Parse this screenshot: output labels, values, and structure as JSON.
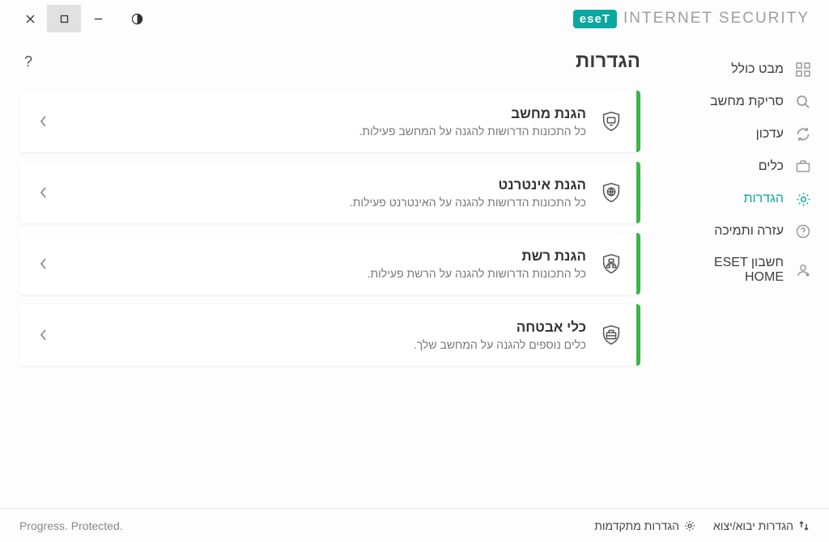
{
  "brand": {
    "logo": "eseT",
    "name": "INTERNET SECURITY"
  },
  "sidebar": {
    "items": [
      {
        "label": "מבט כולל"
      },
      {
        "label": "סריקת מחשב"
      },
      {
        "label": "עדכון"
      },
      {
        "label": "כלים"
      },
      {
        "label": "הגדרות"
      },
      {
        "label": "עזרה ותמיכה"
      },
      {
        "label": "חשבון ESET HOME"
      }
    ]
  },
  "page": {
    "title": "הגדרות",
    "help": "?"
  },
  "cards": [
    {
      "title": "הגנת מחשב",
      "desc": "כל התכונות הדרושות להגנה על המחשב פעילות."
    },
    {
      "title": "הגנת אינטרנט",
      "desc": "כל התכונות הדרושות להגנה על האינטרנט פעילות."
    },
    {
      "title": "הגנת רשת",
      "desc": "כל התכונות הדרושות להגנה על הרשת פעילות."
    },
    {
      "title": "כלי אבטחה",
      "desc": "כלים נוספים להגנה על המחשב שלך."
    }
  ],
  "footer": {
    "tagline": "Progress. Protected.",
    "import": "הגדרות יבוא/יצוא",
    "advanced": "הגדרות מתקדמות"
  }
}
